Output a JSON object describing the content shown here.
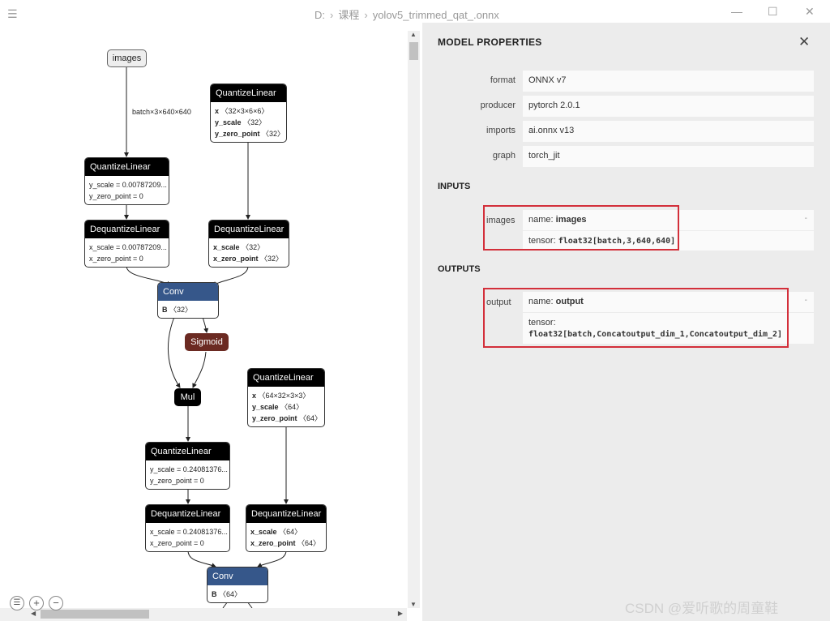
{
  "titlebar": {
    "breadcrumbs": [
      "D:",
      "课程",
      "yolov5_trimmed_qat_.onnx"
    ],
    "minimize_glyph": "—",
    "maximize_glyph": "☐",
    "close_glyph": "✕"
  },
  "graph": {
    "menu_icon": "☰",
    "input_node": "images",
    "input_edge_label": "batch×3×640×640",
    "nodes": {
      "ql1": {
        "title": "QuantizeLinear",
        "l1": "y_scale = 0.00787209...",
        "l2": "y_zero_point = 0"
      },
      "dql1": {
        "title": "DequantizeLinear",
        "l1": "x_scale = 0.00787209...",
        "l2": "x_zero_point = 0"
      },
      "qlw1": {
        "title": "QuantizeLinear",
        "l1k": "x",
        "l1v": "〈32×3×6×6〉",
        "l2k": "y_scale",
        "l2v": "〈32〉",
        "l3k": "y_zero_point",
        "l3v": "〈32〉"
      },
      "dqlw1": {
        "title": "DequantizeLinear",
        "l1k": "x_scale",
        "l1v": "〈32〉",
        "l2k": "x_zero_point",
        "l2v": "〈32〉"
      },
      "conv1": {
        "title": "Conv",
        "l1k": "B",
        "l1v": "〈32〉"
      },
      "sigmoid": "Sigmoid",
      "mul": "Mul",
      "qlw2": {
        "title": "QuantizeLinear",
        "l1k": "x",
        "l1v": "〈64×32×3×3〉",
        "l2k": "y_scale",
        "l2v": "〈64〉",
        "l3k": "y_zero_point",
        "l3v": "〈64〉"
      },
      "ql2": {
        "title": "QuantizeLinear",
        "l1": "y_scale = 0.24081376...",
        "l2": "y_zero_point = 0"
      },
      "dql2": {
        "title": "DequantizeLinear",
        "l1": "x_scale = 0.24081376...",
        "l2": "x_zero_point = 0"
      },
      "dqlw2": {
        "title": "DequantizeLinear",
        "l1k": "x_scale",
        "l1v": "〈64〉",
        "l2k": "x_zero_point",
        "l2v": "〈64〉"
      },
      "conv2": {
        "title": "Conv",
        "l1k": "B",
        "l1v": "〈64〉"
      }
    },
    "zoom": {
      "list_icon": "☰",
      "zoom_in_icon": "+",
      "zoom_out_icon": "−"
    },
    "scroll_up": "▲",
    "scroll_down": "▼",
    "scroll_left": "◀",
    "scroll_right": "▶"
  },
  "panel": {
    "title": "MODEL PROPERTIES",
    "close_glyph": "✕",
    "properties": [
      {
        "label": "format",
        "value": "ONNX v7"
      },
      {
        "label": "producer",
        "value": "pytorch 2.0.1"
      },
      {
        "label": "imports",
        "value": "ai.onnx v13"
      },
      {
        "label": "graph",
        "value": "torch_jit"
      }
    ],
    "inputs_title": "INPUTS",
    "input": {
      "label": "images",
      "name_key": "name:",
      "name": "images",
      "tensor_key": "tensor:",
      "tensor": "float32[batch,3,640,640]",
      "dash": "-"
    },
    "outputs_title": "OUTPUTS",
    "output": {
      "label": "output",
      "name_key": "name:",
      "name": "output",
      "tensor_key": "tensor:",
      "tensor": "float32[batch,Concatoutput_dim_1,Concatoutput_dim_2]",
      "dash": "-"
    }
  },
  "watermark": "CSDN @爱听歌的周童鞋",
  "colors": {
    "accent_conv": "#36578a",
    "sigmoid": "#6b2a22",
    "highlight": "#d32f3a"
  }
}
